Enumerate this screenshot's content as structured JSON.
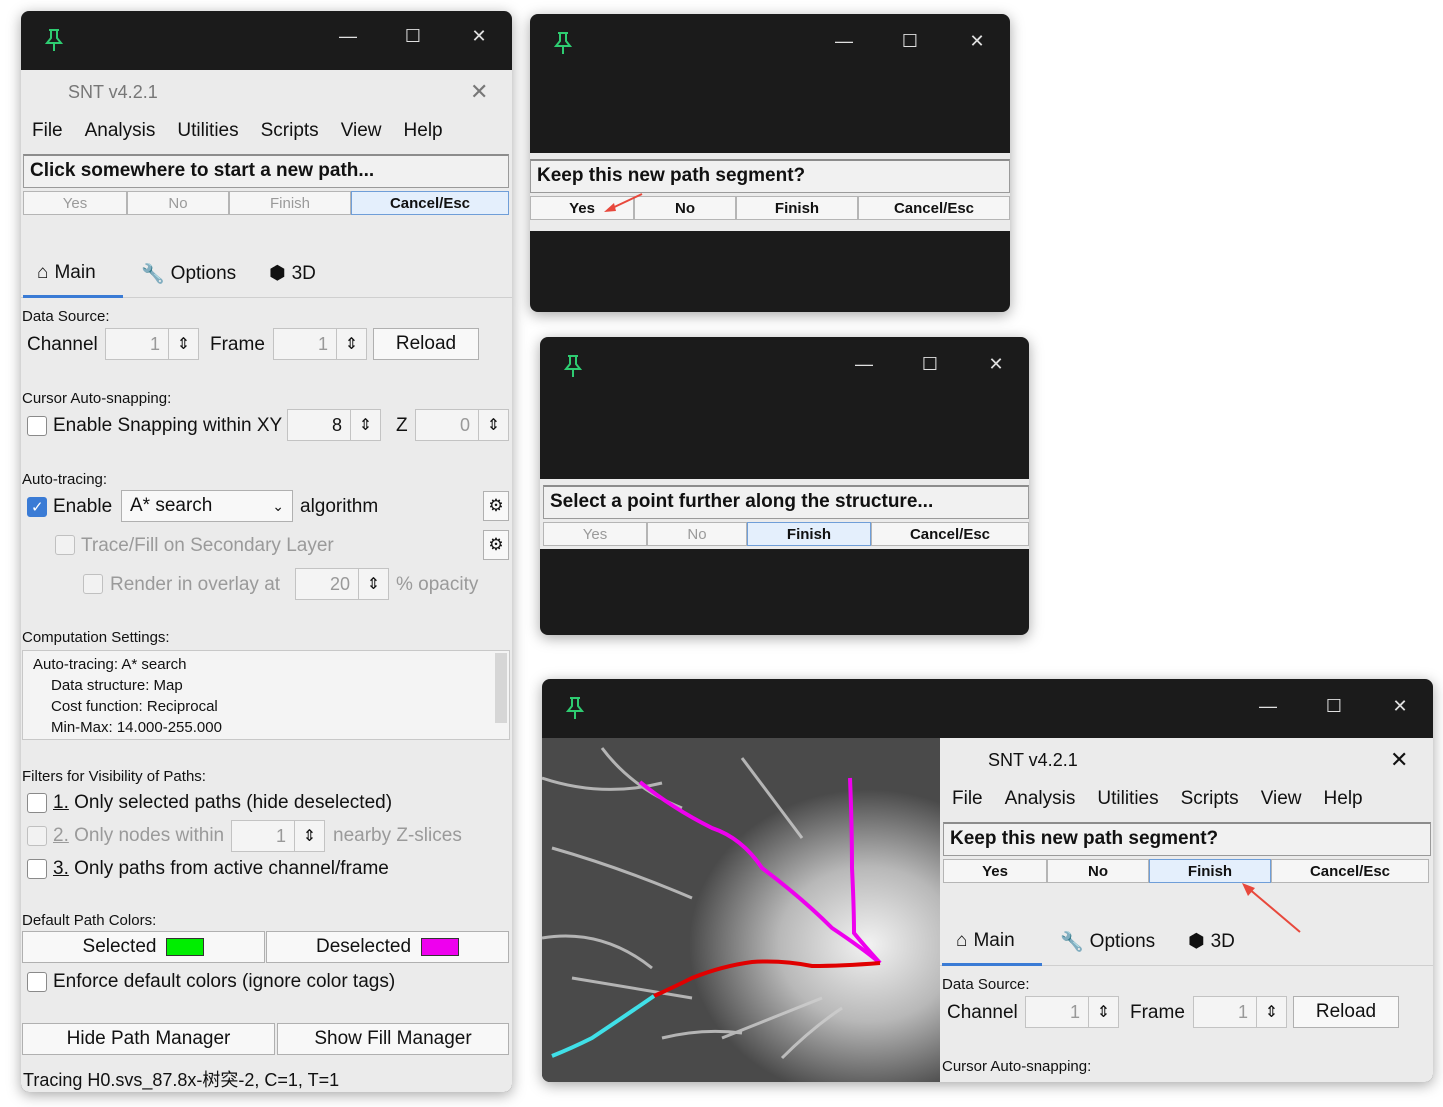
{
  "left_window": {
    "title": "SNT v4.2.1",
    "menu": [
      "File",
      "Analysis",
      "Utilities",
      "Scripts",
      "View",
      "Help"
    ],
    "status": "Click somewhere to start a new path...",
    "buttons": {
      "yes": "Yes",
      "no": "No",
      "finish": "Finish",
      "cancel": "Cancel/Esc"
    },
    "tabs": {
      "main": "Main",
      "options": "Options",
      "3d": "3D"
    },
    "data_source": {
      "label": "Data Source:",
      "channel_label": "Channel",
      "channel_value": "1",
      "frame_label": "Frame",
      "frame_value": "1",
      "reload": "Reload"
    },
    "snapping": {
      "label": "Cursor Auto-snapping:",
      "enable": "Enable Snapping within XY",
      "xy_value": "8",
      "z_label": "Z",
      "z_value": "0"
    },
    "autotracing": {
      "label": "Auto-tracing:",
      "enable": "Enable",
      "algorithm_value": "A* search",
      "algorithm_suffix": "algorithm",
      "secondary": "Trace/Fill on Secondary Layer",
      "render_prefix": "Render in overlay at",
      "opacity_value": "20",
      "render_suffix": "% opacity"
    },
    "computation": {
      "label": "Computation Settings:",
      "lines": [
        "Auto-tracing: A* search",
        "Data structure: Map",
        "Cost function: Reciprocal",
        "Min-Max: 14.000-255.000"
      ]
    },
    "filters": {
      "label": "Filters for Visibility of Paths:",
      "opt1_num": "1.",
      "opt1": "Only selected paths (hide deselected)",
      "opt2_num": "2.",
      "opt2_prefix": "Only nodes within",
      "opt2_value": "1",
      "opt2_suffix": "nearby Z-slices",
      "opt3_num": "3.",
      "opt3": "Only paths from active channel/frame"
    },
    "colors": {
      "label": "Default Path Colors:",
      "selected": "Selected",
      "selected_color": "#00ee00",
      "deselected": "Deselected",
      "deselected_color": "#ee00ee",
      "enforce": "Enforce default colors (ignore color tags)"
    },
    "hide_path_manager": "Hide Path Manager",
    "show_fill_manager": "Show Fill Manager",
    "footer": "Tracing H0.svs_87.8x-树突-2, C=1, T=1"
  },
  "dialog_keep": {
    "text": "Keep this new path segment?",
    "yes": "Yes",
    "no": "No",
    "finish": "Finish",
    "cancel": "Cancel/Esc"
  },
  "dialog_select": {
    "text": "Select a point further along the structure...",
    "yes": "Yes",
    "no": "No",
    "finish": "Finish",
    "cancel": "Cancel/Esc"
  },
  "bottom_window": {
    "title": "SNT v4.2.1",
    "menu": [
      "File",
      "Analysis",
      "Utilities",
      "Scripts",
      "View",
      "Help"
    ],
    "status": "Keep this new path segment?",
    "buttons": {
      "yes": "Yes",
      "no": "No",
      "finish": "Finish",
      "cancel": "Cancel/Esc"
    },
    "tabs": {
      "main": "Main",
      "options": "Options",
      "3d": "3D"
    },
    "data_source": {
      "label": "Data Source:",
      "channel_label": "Channel",
      "channel_value": "1",
      "frame_label": "Frame",
      "frame_value": "1",
      "reload": "Reload"
    },
    "snapping_label": "Cursor Auto-snapping:"
  },
  "colors": {
    "pin": "#2ecc71",
    "arrow": "#e8483c",
    "accent": "#3a7bd5"
  }
}
